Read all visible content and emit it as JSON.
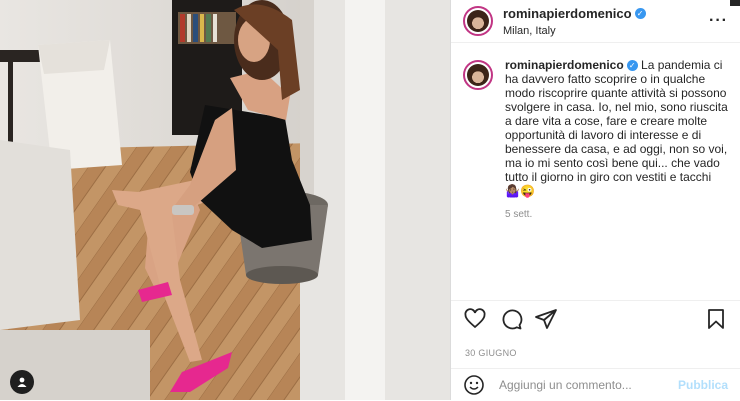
{
  "post": {
    "username": "rominapierdomenico",
    "location": "Milan, Italy",
    "more_icon": "more-horizontal-icon",
    "caption": "La pandemia ci ha davvero fatto scoprire o in qualche modo riscoprire quante attività si possono svolgere in casa. Io, nel mio, sono riuscita a dare vita a cose, fare e creare molte opportunità di lavoro di interesse e di benessere da casa, e ad oggi, non so voi, ma io mi sento così bene qui... che vado tutto il giorno in giro con vestiti e tacchi 🤷🏽‍♀️😜",
    "time_ago": "5 sett.",
    "date": "30 GIUGNO"
  },
  "actions": {
    "like_icon": "heart-icon",
    "comment_icon": "comment-icon",
    "share_icon": "paper-plane-icon",
    "save_icon": "bookmark-icon"
  },
  "comment_bar": {
    "placeholder": "Aggiungi un commento...",
    "publish_label": "Pubblica",
    "emoji_icon": "smiley-icon"
  },
  "colors": {
    "accent": "#3897f0",
    "publish_disabled": "#b2dffc",
    "muted": "#8e8e8e"
  }
}
